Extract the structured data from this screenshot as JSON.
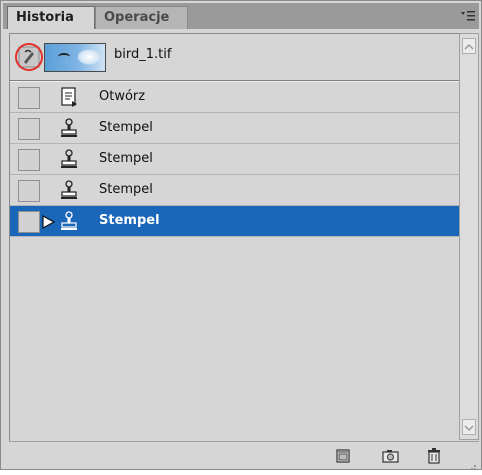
{
  "tabs": [
    {
      "label": "Historia"
    },
    {
      "label": "Operacje"
    }
  ],
  "menu_icon": "panel-menu-icon",
  "snapshot": {
    "name": "bird_1.tif",
    "source_icon": "history-brush-icon"
  },
  "history": [
    {
      "label": "Otwórz",
      "icon": "open-document-icon"
    },
    {
      "label": "Stempel",
      "icon": "clone-stamp-icon"
    },
    {
      "label": "Stempel",
      "icon": "clone-stamp-icon"
    },
    {
      "label": "Stempel",
      "icon": "clone-stamp-icon"
    },
    {
      "label": "Stempel",
      "icon": "clone-stamp-icon",
      "selected": true
    }
  ],
  "footer_icons": [
    "new-document-from-state-icon",
    "new-snapshot-icon",
    "delete-state-icon"
  ],
  "colors": {
    "selection": "#1a66b8",
    "highlight_ring": "#e0312f"
  }
}
